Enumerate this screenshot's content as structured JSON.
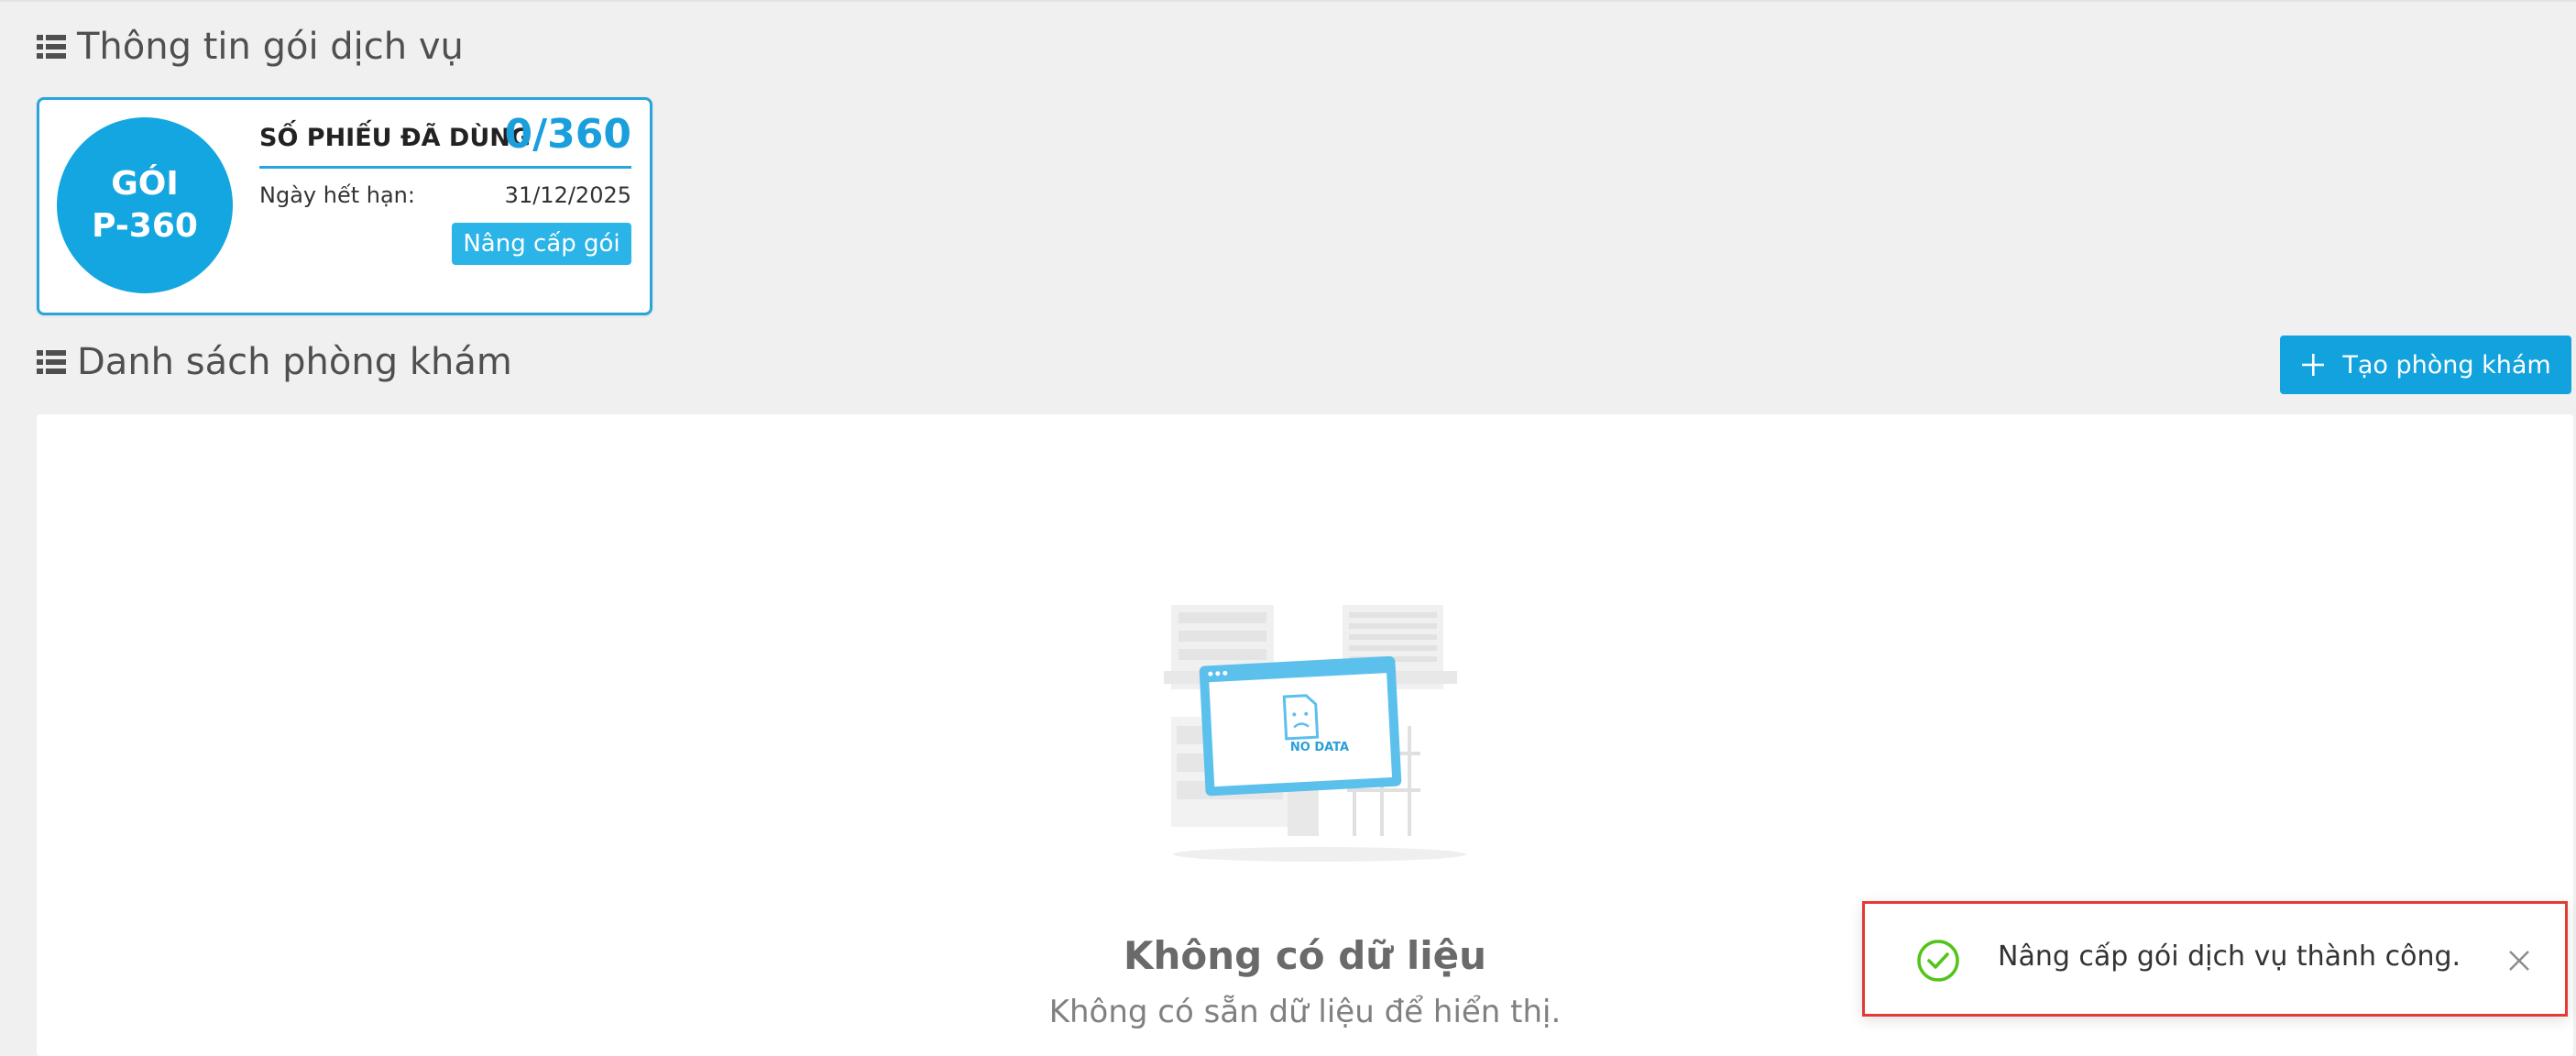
{
  "service_section": {
    "title": "Thông tin gói dịch vụ"
  },
  "package": {
    "name_line1": "GÓI",
    "name_line2": "P-360",
    "used_label": "SỐ PHIẾU ĐÃ DÙNG",
    "used_value": "0/360",
    "expiry_label": "Ngày hết hạn:",
    "expiry_value": "31/12/2025",
    "upgrade_button": "Nâng cấp gói"
  },
  "clinic_section": {
    "title": "Danh sách phòng khám",
    "create_button": "Tạo phòng khám"
  },
  "empty_state": {
    "illustration_text": "NO DATA",
    "title": "Không có dữ liệu",
    "description": "Không có sẵn dữ liệu để hiển thị."
  },
  "toast": {
    "message": "Nâng cấp gói dịch vụ thành công.",
    "icon": "check-circle-icon"
  },
  "colors": {
    "accent": "#12a3df",
    "success": "#52c41a",
    "toast_border": "#e53935"
  }
}
